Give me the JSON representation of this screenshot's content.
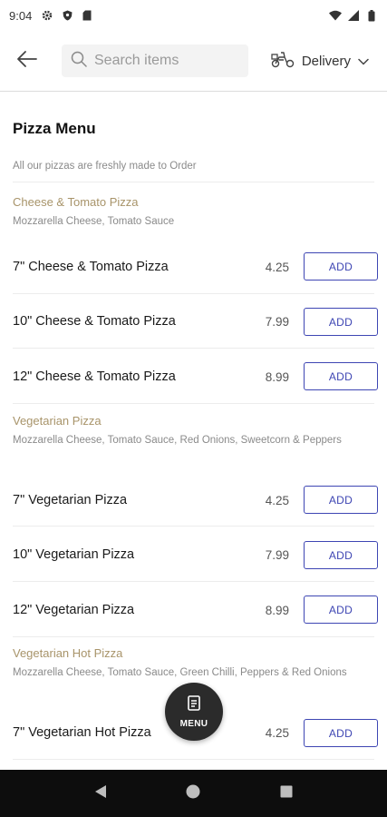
{
  "status_bar": {
    "time": "9:04",
    "icons_left": [
      "gear-icon",
      "shield-icon",
      "sim-card-icon"
    ],
    "icons_right": [
      "wifi-icon",
      "signal-icon",
      "battery-icon"
    ]
  },
  "top_bar": {
    "search_placeholder": "Search items",
    "delivery_label": "Delivery"
  },
  "menu": {
    "title": "Pizza Menu",
    "subtitle": "All our pizzas are freshly made to Order",
    "add_label": "ADD",
    "categories": [
      {
        "name": "Cheese & Tomato Pizza",
        "description": "Mozzarella Cheese, Tomato Sauce",
        "items": [
          {
            "name": "7\" Cheese & Tomato Pizza",
            "price": "4.25"
          },
          {
            "name": "10\" Cheese & Tomato Pizza",
            "price": "7.99"
          },
          {
            "name": "12\" Cheese & Tomato Pizza",
            "price": "8.99"
          }
        ]
      },
      {
        "name": "Vegetarian Pizza",
        "description": "Mozzarella Cheese, Tomato Sauce, Red Onions, Sweetcorn & Peppers",
        "items": [
          {
            "name": "7\" Vegetarian Pizza",
            "price": "4.25"
          },
          {
            "name": "10\" Vegetarian Pizza",
            "price": "7.99"
          },
          {
            "name": "12\" Vegetarian Pizza",
            "price": "8.99"
          }
        ]
      },
      {
        "name": "Vegetarian Hot Pizza",
        "description": "Mozzarella Cheese, Tomato Sauce, Green Chilli, Peppers & Red Onions",
        "items": [
          {
            "name": "7\" Vegetarian Hot Pizza",
            "price": "4.25"
          }
        ]
      }
    ]
  },
  "fab": {
    "label": "MENU"
  },
  "colors": {
    "accent": "#3e46b3",
    "category": "#a8946a",
    "fab_bg": "#2b2b2b",
    "nav_bg": "#0d0d0d"
  }
}
